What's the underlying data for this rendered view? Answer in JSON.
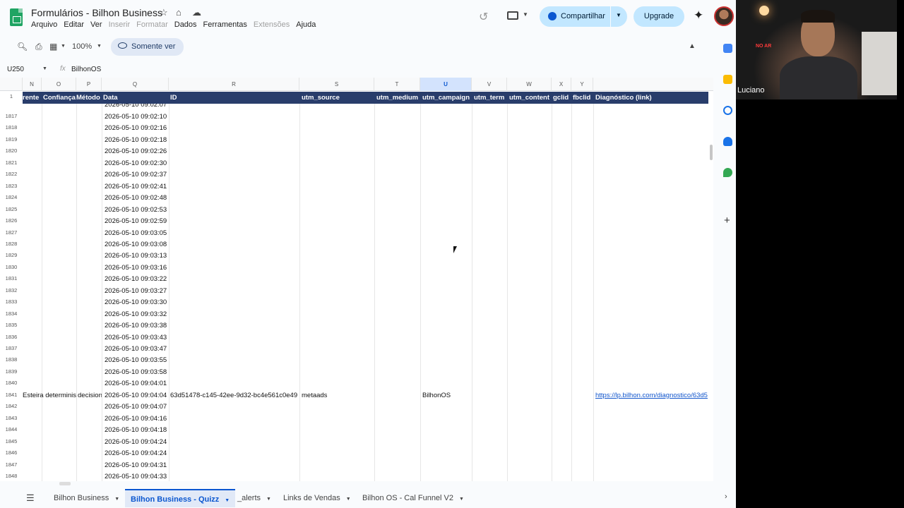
{
  "app": {
    "doc_title": "Formulários - Bilhon Business",
    "menu": [
      "Arquivo",
      "Editar",
      "Ver",
      "Inserir",
      "Formatar",
      "Dados",
      "Ferramentas",
      "Extensões",
      "Ajuda"
    ],
    "share_label": "Compartilhar",
    "upgrade_label": "Upgrade"
  },
  "toolbar": {
    "zoom": "100%",
    "view_only_label": "Somente ver"
  },
  "formula_bar": {
    "cell_ref": "U250",
    "value": "BilhonOS"
  },
  "grid": {
    "columns": [
      "N",
      "O",
      "P",
      "Q",
      "R",
      "S",
      "T",
      "U",
      "V",
      "W",
      "X",
      "Y"
    ],
    "selected_column": "U",
    "header_row_number": "1",
    "headers": [
      "rente",
      "Confiança",
      "Método",
      "Data",
      "ID",
      "utm_source",
      "utm_medium",
      "utm_campaign",
      "utm_term",
      "utm_content",
      "gclid",
      "fbclid",
      "Diagnóstico (link)"
    ],
    "partial_top_date": "2026-05-10 09:02:07",
    "rows": [
      {
        "n": "1817",
        "date": "2026-05-10 09:02:10"
      },
      {
        "n": "1818",
        "date": "2026-05-10 09:02:16"
      },
      {
        "n": "1819",
        "date": "2026-05-10 09:02:18"
      },
      {
        "n": "1820",
        "date": "2026-05-10 09:02:26"
      },
      {
        "n": "1821",
        "date": "2026-05-10 09:02:30"
      },
      {
        "n": "1822",
        "date": "2026-05-10 09:02:37"
      },
      {
        "n": "1823",
        "date": "2026-05-10 09:02:41"
      },
      {
        "n": "1824",
        "date": "2026-05-10 09:02:48"
      },
      {
        "n": "1825",
        "date": "2026-05-10 09:02:53"
      },
      {
        "n": "1826",
        "date": "2026-05-10 09:02:59"
      },
      {
        "n": "1827",
        "date": "2026-05-10 09:03:05"
      },
      {
        "n": "1828",
        "date": "2026-05-10 09:03:08"
      },
      {
        "n": "1829",
        "date": "2026-05-10 09:03:13"
      },
      {
        "n": "1830",
        "date": "2026-05-10 09:03:16"
      },
      {
        "n": "1831",
        "date": "2026-05-10 09:03:22"
      },
      {
        "n": "1832",
        "date": "2026-05-10 09:03:27"
      },
      {
        "n": "1833",
        "date": "2026-05-10 09:03:30"
      },
      {
        "n": "1834",
        "date": "2026-05-10 09:03:32"
      },
      {
        "n": "1835",
        "date": "2026-05-10 09:03:38"
      },
      {
        "n": "1836",
        "date": "2026-05-10 09:03:43"
      },
      {
        "n": "1837",
        "date": "2026-05-10 09:03:47"
      },
      {
        "n": "1838",
        "date": "2026-05-10 09:03:55"
      },
      {
        "n": "1839",
        "date": "2026-05-10 09:03:58"
      },
      {
        "n": "1840",
        "date": "2026-05-10 09:04:01"
      },
      {
        "n": "1841",
        "date": "2026-05-10 09:04:04",
        "frente": "Esteira determinis",
        "metodo": "decision",
        "id": "63d51478-c145-42ee-9d32-bc4e561c0e49",
        "utm_source": "metaads",
        "utm_campaign": "BilhonOS",
        "link": "https://lp.bilhon.com/diagnostico/63d5"
      },
      {
        "n": "1842",
        "date": "2026-05-10 09:04:07"
      },
      {
        "n": "1843",
        "date": "2026-05-10 09:04:16"
      },
      {
        "n": "1844",
        "date": "2026-05-10 09:04:18"
      },
      {
        "n": "1845",
        "date": "2026-05-10 09:04:24"
      },
      {
        "n": "1846",
        "date": "2026-05-10 09:04:24"
      },
      {
        "n": "1847",
        "date": "2026-05-10 09:04:31"
      },
      {
        "n": "1848",
        "date": "2026-05-10 09:04:33"
      }
    ]
  },
  "tabs": [
    {
      "label": "Bilhon Business",
      "active": false
    },
    {
      "label": "Bilhon Business - Quizz",
      "active": true
    },
    {
      "label": "_alerts",
      "active": false
    },
    {
      "label": "Links de Vendas",
      "active": false
    },
    {
      "label": "Bilhon OS - Cal Funnel V2",
      "active": false
    }
  ],
  "webcam": {
    "name": "Luciano",
    "on_air": "NO AR"
  },
  "colors": {
    "header_bg": "#293d6b",
    "accent": "#0b57d0",
    "share_bg": "#c2e7ff"
  }
}
